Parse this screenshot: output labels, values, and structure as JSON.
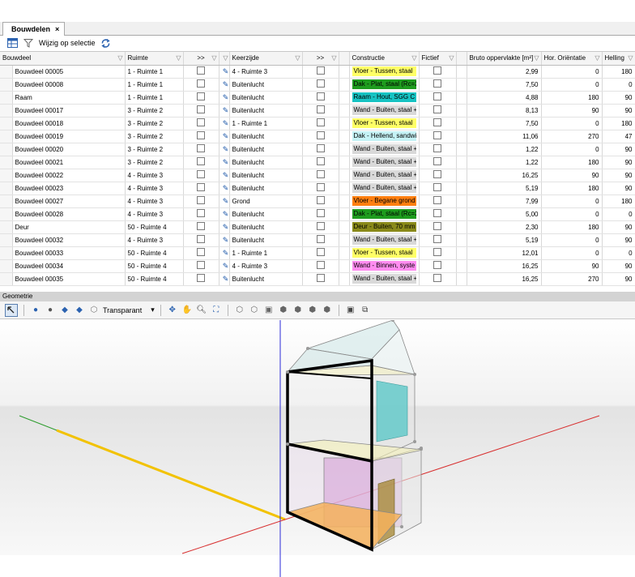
{
  "tab": {
    "label": "Bouwdelen",
    "close": "×"
  },
  "toolbar": {
    "label": "Wijzig op selectie"
  },
  "columns": {
    "bouwdeel": "Bouwdeel",
    "ruimte": "Ruimte",
    "more1": ">>",
    "keerzijde": "Keerzijde",
    "more2": ">>",
    "constructie": "Constructie",
    "fictief": "Fictief",
    "opp": "Bruto oppervlakte [m²]",
    "orient": "Hor. Oriëntatie",
    "helling": "Helling"
  },
  "rows": [
    {
      "name": "Bouwdeel 00005",
      "ruimte": "1 - Ruimte 1",
      "keerzijde": "4 - Ruimte 3",
      "constructie": "Vloer - Tussen, staal",
      "color": "#ffff66",
      "opp": "2,99",
      "orient": "0",
      "helling": "180"
    },
    {
      "name": "Bouwdeel 00008",
      "ruimte": "1 - Ruimte 1",
      "keerzijde": "Buitenlucht",
      "constructie": "Dak - Plat, staal (Rc=2",
      "color": "#1e9c1e",
      "opp": "7,50",
      "orient": "0",
      "helling": "0"
    },
    {
      "name": "Raam",
      "ruimte": "1 - Ruimte 1",
      "keerzijde": "Buitenlucht",
      "constructie": "Raam - Hout, SGG C",
      "color": "#17c3c3",
      "opp": "4,88",
      "orient": "180",
      "helling": "90"
    },
    {
      "name": "Bouwdeel 00017",
      "ruimte": "3 - Ruimte 2",
      "keerzijde": "Buitenlucht",
      "constructie": "Wand - Buiten, staal +",
      "color": "#d9d9d9",
      "opp": "8,13",
      "orient": "90",
      "helling": "90"
    },
    {
      "name": "Bouwdeel 00018",
      "ruimte": "3 - Ruimte 2",
      "keerzijde": "1 - Ruimte 1",
      "constructie": "Vloer - Tussen, staal",
      "color": "#ffff66",
      "opp": "7,50",
      "orient": "0",
      "helling": "180"
    },
    {
      "name": "Bouwdeel 00019",
      "ruimte": "3 - Ruimte 2",
      "keerzijde": "Buitenlucht",
      "constructie": "Dak - Hellend, sandwi",
      "color": "#c5f2f5",
      "opp": "11,06",
      "orient": "270",
      "helling": "47"
    },
    {
      "name": "Bouwdeel 00020",
      "ruimte": "3 - Ruimte 2",
      "keerzijde": "Buitenlucht",
      "constructie": "Wand - Buiten, staal +",
      "color": "#d9d9d9",
      "opp": "1,22",
      "orient": "0",
      "helling": "90"
    },
    {
      "name": "Bouwdeel 00021",
      "ruimte": "3 - Ruimte 2",
      "keerzijde": "Buitenlucht",
      "constructie": "Wand - Buiten, staal +",
      "color": "#d9d9d9",
      "opp": "1,22",
      "orient": "180",
      "helling": "90"
    },
    {
      "name": "Bouwdeel 00022",
      "ruimte": "4 - Ruimte 3",
      "keerzijde": "Buitenlucht",
      "constructie": "Wand - Buiten, staal +",
      "color": "#d9d9d9",
      "opp": "16,25",
      "orient": "90",
      "helling": "90"
    },
    {
      "name": "Bouwdeel 00023",
      "ruimte": "4 - Ruimte 3",
      "keerzijde": "Buitenlucht",
      "constructie": "Wand - Buiten, staal +",
      "color": "#d9d9d9",
      "opp": "5,19",
      "orient": "180",
      "helling": "90"
    },
    {
      "name": "Bouwdeel 00027",
      "ruimte": "4 - Ruimte 3",
      "keerzijde": "Grond",
      "constructie": "Vloer - Begane grond",
      "color": "#ff7f10",
      "opp": "7,99",
      "orient": "0",
      "helling": "180"
    },
    {
      "name": "Bouwdeel 00028",
      "ruimte": "4 - Ruimte 3",
      "keerzijde": "Buitenlucht",
      "constructie": "Dak - Plat, staal (Rc=2",
      "color": "#1e9c1e",
      "opp": "5,00",
      "orient": "0",
      "helling": "0"
    },
    {
      "name": "Deur",
      "ruimte": "50 - Ruimte 4",
      "keerzijde": "Buitenlucht",
      "constructie": "Deur - Buiten, 70 mm",
      "color": "#8a8a1a",
      "opp": "2,30",
      "orient": "180",
      "helling": "90"
    },
    {
      "name": "Bouwdeel 00032",
      "ruimte": "4 - Ruimte 3",
      "keerzijde": "Buitenlucht",
      "constructie": "Wand - Buiten, staal +",
      "color": "#d9d9d9",
      "opp": "5,19",
      "orient": "0",
      "helling": "90"
    },
    {
      "name": "Bouwdeel 00033",
      "ruimte": "50 - Ruimte 4",
      "keerzijde": "1 - Ruimte 1",
      "constructie": "Vloer - Tussen, staal",
      "color": "#ffff66",
      "opp": "12,01",
      "orient": "0",
      "helling": "0"
    },
    {
      "name": "Bouwdeel 00034",
      "ruimte": "50 - Ruimte 4",
      "keerzijde": "4 - Ruimte 3",
      "constructie": "Wand - Binnen, syste",
      "color": "#ff8cf0",
      "opp": "16,25",
      "orient": "90",
      "helling": "90"
    },
    {
      "name": "Bouwdeel 00035",
      "ruimte": "50 - Ruimte 4",
      "keerzijde": "Buitenlucht",
      "constructie": "Wand - Buiten, staal +",
      "color": "#d9d9d9",
      "opp": "16,25",
      "orient": "270",
      "helling": "90"
    }
  ],
  "geometry": {
    "header": "Geometrie",
    "dropdown": "Transparant"
  },
  "icons": {
    "table": "table-icon",
    "filter": "filter-icon",
    "refresh": "refresh-icon",
    "select": "select-arrow-icon",
    "pen": "pencil-icon"
  },
  "colors": {
    "accent": "#2b62b0",
    "header_bg": "#d3d3d3"
  }
}
